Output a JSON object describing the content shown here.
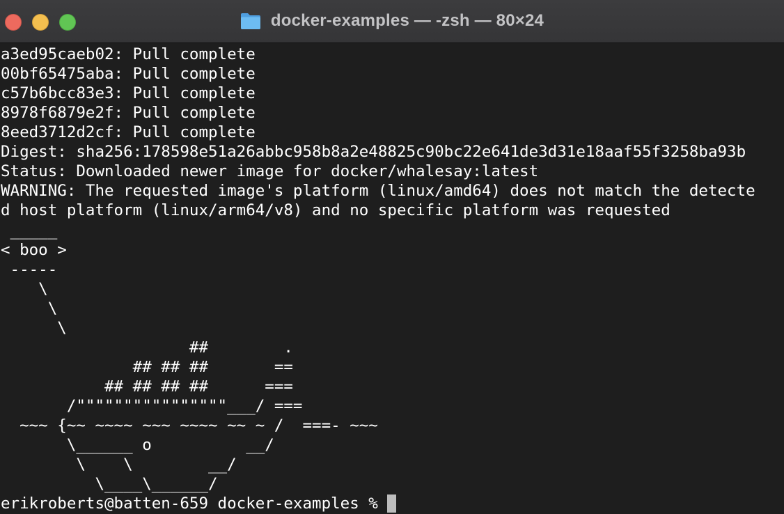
{
  "window": {
    "title": "docker-examples — -zsh — 80×24"
  },
  "colors": {
    "background": "#1e1e1e",
    "text": "#ffffff",
    "titlebar": "#3a3a3c",
    "close": "#ed6a5e",
    "minimize": "#f4bf4f",
    "zoom": "#61c554",
    "folder": "#5aaee8"
  },
  "icons": {
    "folder": "folder-icon"
  },
  "terminal": {
    "lines": [
      "a3ed95caeb02: Pull complete",
      "00bf65475aba: Pull complete",
      "c57b6bcc83e3: Pull complete",
      "8978f6879e2f: Pull complete",
      "8eed3712d2cf: Pull complete",
      "Digest: sha256:178598e51a26abbc958b8a2e48825c90bc22e641de3d31e18aaf55f3258ba93b",
      "Status: Downloaded newer image for docker/whalesay:latest",
      "WARNING: The requested image's platform (linux/amd64) does not match the detecte",
      "d host platform (linux/arm64/v8) and no specific platform was requested",
      " _____",
      "< boo >",
      " -----",
      "    \\",
      "     \\",
      "      \\",
      "                    ##        .",
      "              ## ## ##       ==",
      "           ## ## ## ##      ===",
      "       /\"\"\"\"\"\"\"\"\"\"\"\"\"\"\"\"___/ ===",
      "  ~~~ {~~ ~~~~ ~~~ ~~~~ ~~ ~ /  ===- ~~~",
      "       \\______ o          __/",
      "        \\    \\        __/",
      "          \\____\\______/"
    ],
    "prompt": "erikroberts@batten-659 docker-examples % "
  }
}
